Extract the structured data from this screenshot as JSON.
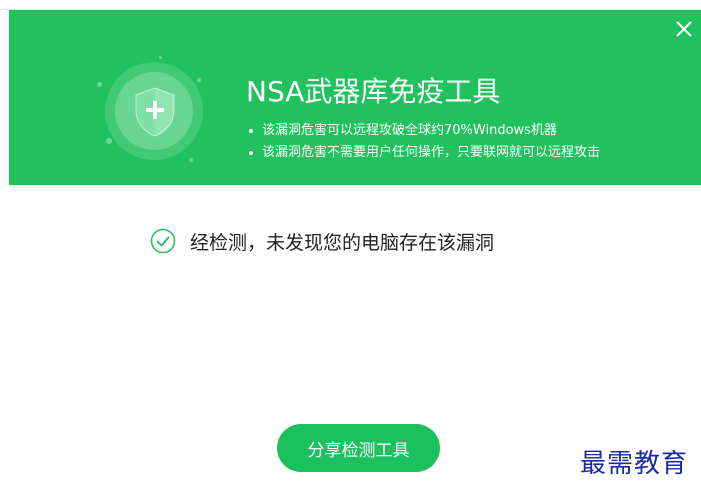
{
  "header": {
    "title": "NSA武器库免疫工具",
    "bullets": [
      "该漏洞危害可以远程攻破全球约70%Windows机器",
      "该漏洞危害不需要用户任何操作，只要联网就可以远程攻击"
    ],
    "close_icon": "close-icon",
    "shield_icon": "shield-plus-icon",
    "background_color": "#21c25e"
  },
  "result": {
    "icon": "check-circle-icon",
    "text": "经检测，未发现您的电脑存在该漏洞",
    "icon_color": "#21c25e"
  },
  "actions": {
    "share_label": "分享检测工具",
    "button_color": "#1bc15c"
  },
  "watermark": {
    "text": "最需教育",
    "color": "#1a2aa6"
  }
}
